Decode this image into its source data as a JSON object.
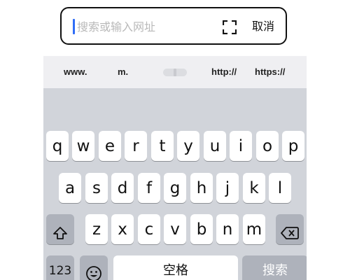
{
  "search": {
    "placeholder": "搜索或输入网址",
    "cancel_label": "取消"
  },
  "suggestions": [
    "www.",
    "m.",
    "http://",
    "https://"
  ],
  "keyboard": {
    "row1": [
      "q",
      "w",
      "e",
      "r",
      "t",
      "y",
      "u",
      "i",
      "o",
      "p"
    ],
    "row2": [
      "a",
      "s",
      "d",
      "f",
      "g",
      "h",
      "j",
      "k",
      "l"
    ],
    "row3": [
      "z",
      "x",
      "c",
      "v",
      "b",
      "n",
      "m"
    ],
    "numbers_label": "123",
    "space_label": "空格",
    "search_key_label": "搜索"
  },
  "icons": {
    "shift": "shift-icon",
    "delete": "backspace-icon",
    "emoji": "emoji-icon",
    "scan": "scan-icon"
  },
  "colors": {
    "caret": "#2f6df6",
    "keyboard_bg": "#d1d4da",
    "function_key": "#aeb2bb"
  }
}
